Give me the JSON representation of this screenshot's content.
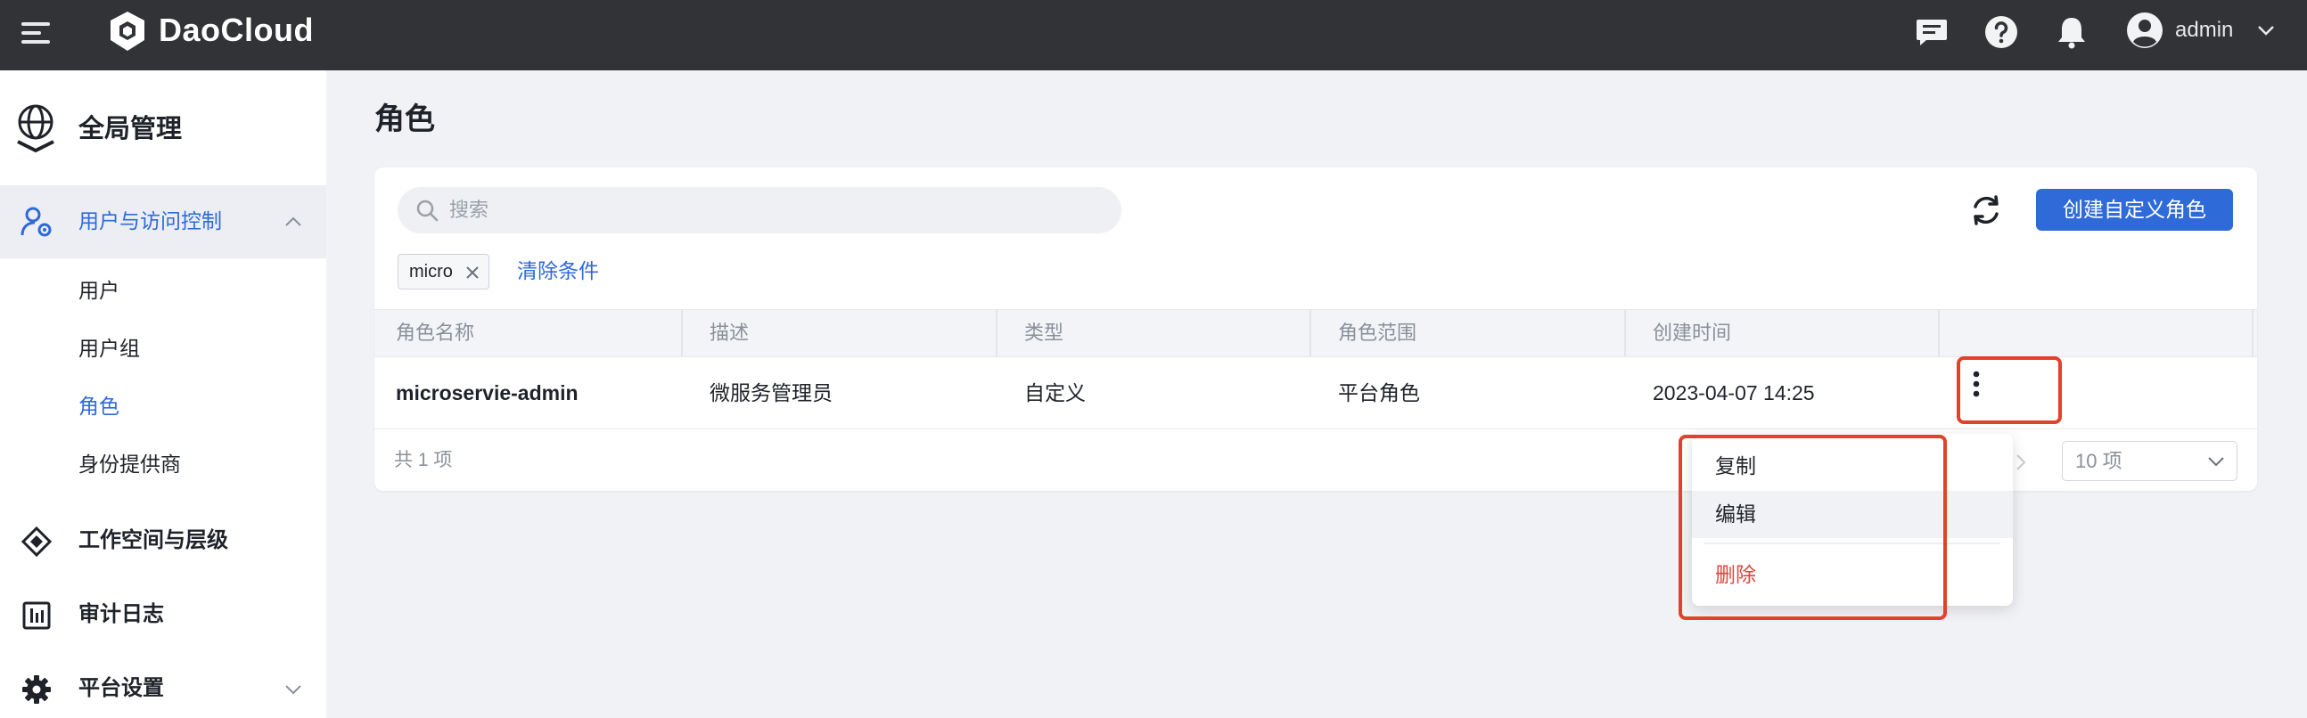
{
  "header": {
    "brand": "DaoCloud",
    "username": "admin",
    "icons": [
      "menu-icon",
      "daocloud-logo-icon",
      "message-icon",
      "help-icon",
      "bell-icon",
      "user-avatar-icon",
      "chevron-down-icon"
    ]
  },
  "sidebar": {
    "module_title": "全局管理",
    "group": {
      "label": "用户与访问控制",
      "expanded": true
    },
    "sub_items": [
      {
        "label": "用户",
        "active": false
      },
      {
        "label": "用户组",
        "active": false
      },
      {
        "label": "角色",
        "active": true
      },
      {
        "label": "身份提供商",
        "active": false
      }
    ],
    "items": [
      {
        "label": "工作空间与层级",
        "icon": "workspace-icon"
      },
      {
        "label": "审计日志",
        "icon": "audit-log-icon"
      },
      {
        "label": "平台设置",
        "icon": "gear-icon"
      }
    ]
  },
  "main": {
    "title": "角色",
    "search": {
      "placeholder": "搜索",
      "value": ""
    },
    "create_button": "创建自定义角色",
    "filter_tag": "micro",
    "clear_filters": "清除条件",
    "columns": [
      "角色名称",
      "描述",
      "类型",
      "角色范围",
      "创建时间"
    ],
    "rows": [
      {
        "name": "microservie-admin",
        "description": "微服务管理员",
        "type": "自定义",
        "scope": "平台角色",
        "created": "2023-04-07 14:25"
      }
    ],
    "total": "共 1 项",
    "page_size": "10 项"
  },
  "row_menu": {
    "items": [
      {
        "label": "复制",
        "hover": false,
        "danger": false
      },
      {
        "label": "编辑",
        "hover": true,
        "danger": false
      },
      {
        "label": "删除",
        "hover": false,
        "danger": true
      }
    ]
  },
  "colors": {
    "topbar": "#323337",
    "accent": "#2f6ad9",
    "danger": "#e0443c",
    "annotation": "#e2412a"
  }
}
